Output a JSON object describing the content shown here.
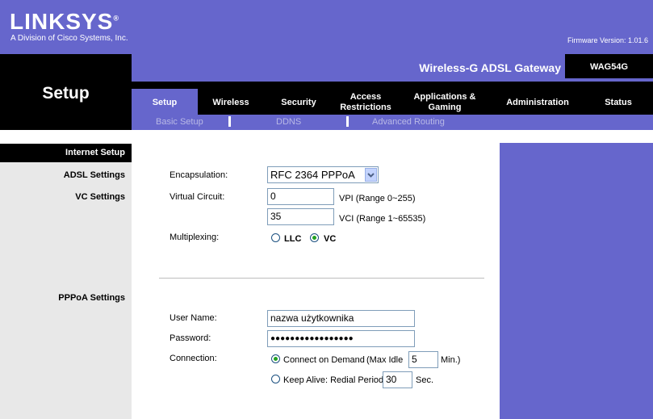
{
  "header": {
    "logo": "LINKSYS",
    "logo_reg": "®",
    "subtitle": "A Division of Cisco Systems, Inc.",
    "firmware": "Firmware Version: 1.01.6",
    "product": "Wireless-G ADSL Gateway",
    "model": "WAG54G",
    "section_title": "Setup"
  },
  "tabs": [
    {
      "label": "Setup"
    },
    {
      "label": "Wireless"
    },
    {
      "label": "Security"
    },
    {
      "label": "Access Restrictions"
    },
    {
      "label": "Applications & Gaming"
    },
    {
      "label": "Administration"
    },
    {
      "label": "Status"
    }
  ],
  "subtabs": [
    "Basic Setup",
    "DDNS",
    "Advanced Routing"
  ],
  "sections": {
    "internet_setup": "Internet Setup",
    "adsl": "ADSL Settings",
    "vc": "VC Settings",
    "pppoa": "PPPoA Settings"
  },
  "form": {
    "encapsulation_label": "Encapsulation:",
    "encapsulation_value": "RFC 2364 PPPoA",
    "virtual_circuit_label": "Virtual Circuit:",
    "vpi_value": "0",
    "vpi_hint": "VPI (Range 0~255)",
    "vci_value": "35",
    "vci_hint": "VCI (Range 1~65535)",
    "multiplexing_label": "Multiplexing:",
    "llc": "LLC",
    "vc": "VC",
    "username_label": "User Name:",
    "username_value": "nazwa użytkownika",
    "password_label": "Password:",
    "password_value": "●●●●●●●●●●●●●●●●●",
    "connection_label": "Connection:",
    "connect_on_demand": "Connect on Demand",
    "max_idle_label": "(Max Idle",
    "max_idle_value": "5",
    "min_label": "Min.)",
    "keep_alive": "Keep Alive: Redial Period",
    "redial_value": "30",
    "sec_label": "Sec."
  },
  "colors": {
    "brand": "#6666cc",
    "band": "#000000"
  }
}
